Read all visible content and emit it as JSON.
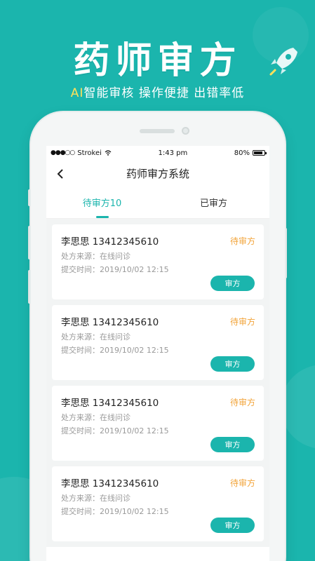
{
  "hero": {
    "title": "药师审方",
    "subtitle_accent": "AI",
    "subtitle_rest": "智能审核 操作便捷 出错率低"
  },
  "colors": {
    "brand": "#1bb5ad",
    "pending": "#f2a43a",
    "accent_yellow": "#ffe15a"
  },
  "statusbar": {
    "carrier": "Strokei",
    "time": "1:43 pm",
    "battery": "80%"
  },
  "nav": {
    "back_icon": "chevron-left-icon",
    "title": "药师审方系统"
  },
  "tabs": [
    {
      "label": "待审方10",
      "active": true
    },
    {
      "label": "已审方",
      "active": false
    }
  ],
  "prescriptions": [
    {
      "patient": "李思思 13412345610",
      "status": "待审方",
      "source": "处方来源：在线问诊",
      "submitted": "提交时间：2019/10/02 12:15",
      "action": "审方"
    },
    {
      "patient": "李思思 13412345610",
      "status": "待审方",
      "source": "处方来源：在线问诊",
      "submitted": "提交时间：2019/10/02 12:15",
      "action": "审方"
    },
    {
      "patient": "李思思 13412345610",
      "status": "待审方",
      "source": "处方来源：在线问诊",
      "submitted": "提交时间：2019/10/02 12:15",
      "action": "审方"
    },
    {
      "patient": "李思思 13412345610",
      "status": "待审方",
      "source": "处方来源：在线问诊",
      "submitted": "提交时间：2019/10/02 12:15",
      "action": "审方"
    }
  ]
}
